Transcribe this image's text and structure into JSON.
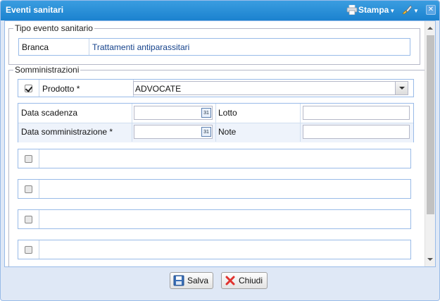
{
  "window": {
    "title": "Eventi sanitari"
  },
  "toolbar": {
    "stampa_label": "Stampa",
    "icons": [
      "printer-icon",
      "brush-icon",
      "close-icon"
    ]
  },
  "tipo_evento": {
    "legend": "Tipo evento sanitario",
    "label": "Branca",
    "value": "Trattamenti antiparassitari"
  },
  "somministrazioni": {
    "legend": "Somministrazioni",
    "prodotto": {
      "checked": true,
      "label": "Prodotto *",
      "value": "ADVOCATE"
    },
    "fields": {
      "data_scadenza_label": "Data scadenza",
      "lotto_label": "Lotto",
      "data_somministrazione_label": "Data somministrazione *",
      "note_label": "Note"
    },
    "empty_rows": 4
  },
  "buttons": {
    "salva": "Salva",
    "chiudi": "Chiudi"
  },
  "colors": {
    "titlebar": "#1b82cf",
    "accent_blue": "#15428b",
    "border_blue": "#99bbe8"
  }
}
